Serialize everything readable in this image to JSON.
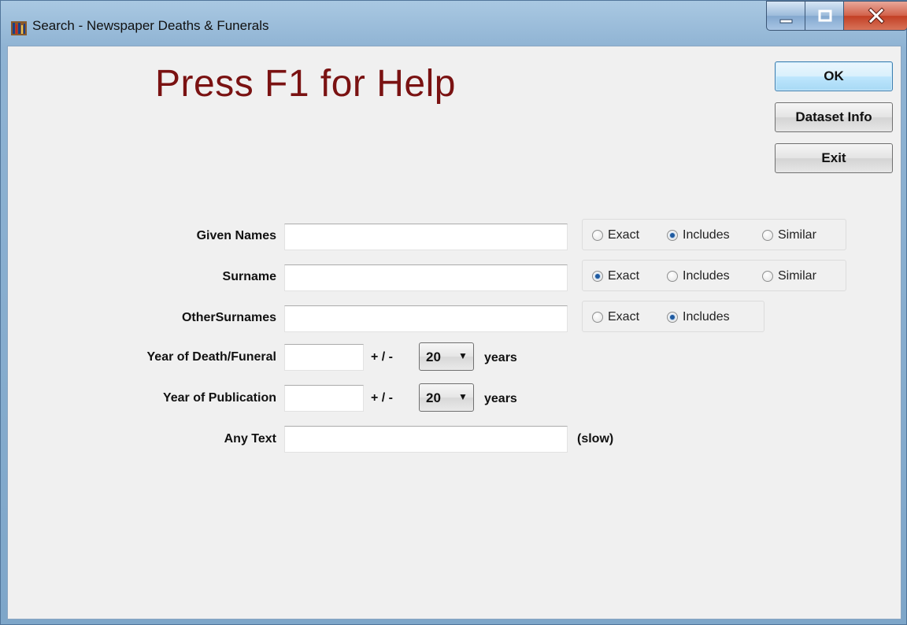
{
  "window": {
    "title": "Search - Newspaper Deaths & Funerals"
  },
  "header": {
    "help_text": "Press F1 for Help"
  },
  "buttons": {
    "ok": "OK",
    "dataset_info": "Dataset Info",
    "exit": "Exit"
  },
  "fields": {
    "given_names": {
      "label": "Given Names",
      "value": ""
    },
    "surname": {
      "label": "Surname",
      "value": ""
    },
    "other_surnames": {
      "label": "OtherSurnames",
      "value": ""
    },
    "year_death": {
      "label": "Year of Death/Funeral",
      "value": ""
    },
    "year_publication": {
      "label": "Year of Publication",
      "value": ""
    },
    "any_text": {
      "label": "Any Text",
      "value": "",
      "note": "(slow)"
    }
  },
  "match_options": {
    "exact": "Exact",
    "includes": "Includes",
    "similar": "Similar"
  },
  "match_selected": {
    "given_names": "Includes",
    "surname": "Exact",
    "other_surnames": "Includes"
  },
  "range": {
    "plus_minus": "+ / -",
    "years": "years",
    "death_range": "20",
    "publication_range": "20"
  },
  "colors": {
    "help_text": "#7a1212",
    "radio_selected": "#1f5aa0"
  },
  "icons": {
    "app": "bookshelf-icon",
    "minimize": "minimize-icon",
    "maximize": "maximize-icon",
    "close": "close-icon",
    "dropdown": "chevron-down-icon"
  }
}
